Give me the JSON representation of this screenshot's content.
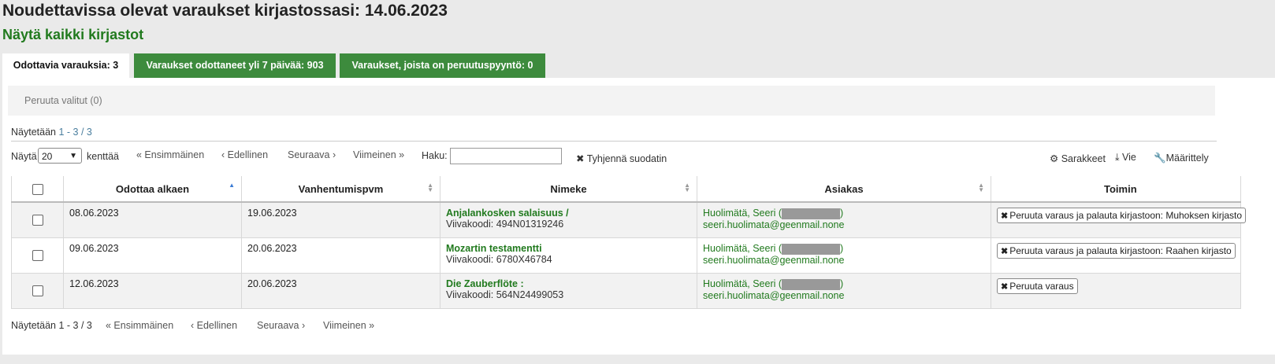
{
  "page": {
    "title": "Noudettavissa olevat varaukset kirjastossasi: 14.06.2023",
    "show_all": "Näytä kaikki kirjastot"
  },
  "tabs": [
    {
      "label": "Odottavia varauksia: 3"
    },
    {
      "label": "Varaukset odottaneet yli 7 päivää: 903"
    },
    {
      "label": "Varaukset, joista on peruutuspyyntö: 0"
    }
  ],
  "toolbar": {
    "cancel_selected": "Peruuta valitut (0)"
  },
  "info": {
    "prefix": "Näytetään ",
    "range": "1 - 3 / 3"
  },
  "controls": {
    "show_label": "Näytä",
    "page_size": "20",
    "entries_label": "kenttää",
    "first": "« Ensimmäinen",
    "prev": "‹ Edellinen",
    "next": "Seuraava ›",
    "last": "Viimeinen »",
    "search_label": "Haku:",
    "clear_filter": "✖ Tyhjennä suodatin",
    "columns": "Sarakkeet",
    "export": "Vie",
    "configure": "Määrittely"
  },
  "table": {
    "headers": [
      "Odottaa alkaen",
      "Vanhentumispvm",
      "Nimeke",
      "Asiakas",
      "Toimin"
    ],
    "rows": [
      {
        "waiting_since": "08.06.2023",
        "expires": "19.06.2023",
        "title": "Anjalankosken salaisuus /",
        "barcode": "Viivakoodi: 494N01319246",
        "patron": "Huolimätä, Seeri (",
        "patron_close": ")",
        "email": "seeri.huolimata@geenmail.none",
        "action": "Peruuta varaus ja palauta kirjastoon: Muhoksen kirjasto"
      },
      {
        "waiting_since": "09.06.2023",
        "expires": "20.06.2023",
        "title": "Mozartin testamentti",
        "barcode": "Viivakoodi: 6780X46784",
        "patron": "Huolimätä, Seeri (",
        "patron_close": ")",
        "email": "seeri.huolimata@geenmail.none",
        "action": "Peruuta varaus ja palauta kirjastoon: Raahen kirjasto"
      },
      {
        "waiting_since": "12.06.2023",
        "expires": "20.06.2023",
        "title": "Die Zauberflöte :",
        "barcode": "Viivakoodi: 564N24499053",
        "patron": "Huolimätä, Seeri (",
        "patron_close": ")",
        "email": "seeri.huolimata@geenmail.none",
        "action": "Peruuta varaus"
      }
    ]
  },
  "bottom": {
    "info": "Näytetään 1 - 3 / 3",
    "first": "« Ensimmäinen",
    "prev": "‹ Edellinen",
    "next": "Seuraava ›",
    "last": "Viimeinen »"
  },
  "icons": {
    "gear": "gear-icon",
    "download": "download-icon",
    "wrench": "wrench-icon",
    "close": "close-icon"
  },
  "colors": {
    "accent": "#3d8b3d",
    "link": "#217a1e"
  }
}
